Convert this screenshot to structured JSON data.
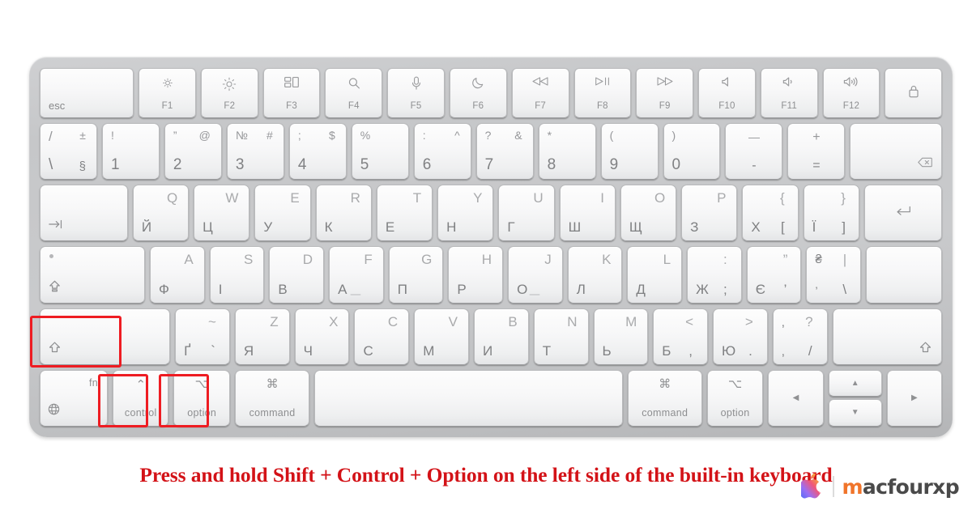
{
  "caption": "Press and hold Shift + Control + Option on the left side of the built-in keyboard",
  "brand": {
    "name_first": "m",
    "name_rest": "acfourxp",
    "apple_icon": "apple-logo-icon"
  },
  "colors": {
    "highlight": "#ee1c22",
    "caption_text": "#d31217",
    "key_face": "#f7f7f8",
    "chassis": "#c6c7c9",
    "latin_legend": "#a9aaac",
    "cyrillic_legend": "#7f8082"
  },
  "keyboard": {
    "layout_name": "Apple Magic Keyboard (Ukrainian / Latin)",
    "function_row": [
      {
        "name": "esc",
        "label": "esc"
      },
      {
        "name": "f1",
        "icon": "brightness-down-icon",
        "label": "F1"
      },
      {
        "name": "f2",
        "icon": "brightness-up-icon",
        "label": "F2"
      },
      {
        "name": "f3",
        "icon": "mission-control-icon",
        "label": "F3"
      },
      {
        "name": "f4",
        "icon": "spotlight-search-icon",
        "label": "F4"
      },
      {
        "name": "f5",
        "icon": "dictation-microphone-icon",
        "label": "F5"
      },
      {
        "name": "f6",
        "icon": "do-not-disturb-moon-icon",
        "label": "F6"
      },
      {
        "name": "f7",
        "icon": "rewind-icon",
        "label": "F7"
      },
      {
        "name": "f8",
        "icon": "play-pause-icon",
        "label": "F8"
      },
      {
        "name": "f9",
        "icon": "fast-forward-icon",
        "label": "F9"
      },
      {
        "name": "f10",
        "icon": "mute-icon",
        "label": "F10"
      },
      {
        "name": "f11",
        "icon": "volume-down-icon",
        "label": "F11"
      },
      {
        "name": "f12",
        "icon": "volume-up-icon",
        "label": "F12"
      },
      {
        "name": "touch-id",
        "icon": "lock-fingerprint-icon",
        "label": ""
      }
    ],
    "number_row": [
      {
        "name": "backslash",
        "top_left": "/",
        "bottom_left": "\\",
        "top_right": "±",
        "bottom_right": "§"
      },
      {
        "name": "1",
        "top_left": "!",
        "bottom_left": "1"
      },
      {
        "name": "2",
        "top_left": "”",
        "bottom_left": "2",
        "top_right": "@"
      },
      {
        "name": "3",
        "top_left": "№",
        "bottom_left": "3",
        "top_right": "#"
      },
      {
        "name": "4",
        "top_left": ";",
        "bottom_left": "4",
        "top_right": "$"
      },
      {
        "name": "5",
        "top_left": "%",
        "bottom_left": "5"
      },
      {
        "name": "6",
        "top_left": ":",
        "bottom_left": "6",
        "top_right": "^"
      },
      {
        "name": "7",
        "top_left": "?",
        "bottom_left": "7",
        "top_right": "&"
      },
      {
        "name": "8",
        "top_left": "*",
        "bottom_left": "8"
      },
      {
        "name": "9",
        "top_left": "(",
        "bottom_left": "9"
      },
      {
        "name": "0",
        "top_left": ")",
        "bottom_left": "0"
      },
      {
        "name": "minus",
        "top_center": "—",
        "bottom_center": "-"
      },
      {
        "name": "equals",
        "top_center": "+",
        "bottom_center": "="
      },
      {
        "name": "delete",
        "icon": "delete-backspace-icon"
      }
    ],
    "top_row": [
      {
        "name": "tab",
        "icon": "tab-arrow-icon"
      },
      {
        "name": "q",
        "latin": "Q",
        "cyrillic": "Й"
      },
      {
        "name": "w",
        "latin": "W",
        "cyrillic": "Ц"
      },
      {
        "name": "e",
        "latin": "E",
        "cyrillic": "У"
      },
      {
        "name": "r",
        "latin": "R",
        "cyrillic": "К"
      },
      {
        "name": "t",
        "latin": "T",
        "cyrillic": "Е"
      },
      {
        "name": "y",
        "latin": "Y",
        "cyrillic": "Н"
      },
      {
        "name": "u",
        "latin": "U",
        "cyrillic": "Г"
      },
      {
        "name": "i",
        "latin": "I",
        "cyrillic": "Ш"
      },
      {
        "name": "o",
        "latin": "O",
        "cyrillic": "Щ"
      },
      {
        "name": "p",
        "latin": "P",
        "cyrillic": "З"
      },
      {
        "name": "bracket-left",
        "latin": "{",
        "cyrillic": "Х",
        "extra_bottom": "["
      },
      {
        "name": "bracket-right",
        "latin": "}",
        "cyrillic": "Ї",
        "extra_bottom": "]"
      },
      {
        "name": "return",
        "icon": "return-enter-icon"
      }
    ],
    "home_row": [
      {
        "name": "caps-lock",
        "icon": "caps-lock-arrow-icon",
        "indicator": "caps-lock-indicator"
      },
      {
        "name": "a",
        "latin": "A",
        "cyrillic": "Ф"
      },
      {
        "name": "s",
        "latin": "S",
        "cyrillic": "І"
      },
      {
        "name": "d",
        "latin": "D",
        "cyrillic": "В"
      },
      {
        "name": "f",
        "latin": "F",
        "cyrillic": "А",
        "homing": true
      },
      {
        "name": "g",
        "latin": "G",
        "cyrillic": "П"
      },
      {
        "name": "h",
        "latin": "H",
        "cyrillic": "Р"
      },
      {
        "name": "j",
        "latin": "J",
        "cyrillic": "О",
        "homing": true
      },
      {
        "name": "k",
        "latin": "K",
        "cyrillic": "Л"
      },
      {
        "name": "l",
        "latin": "L",
        "cyrillic": "Д"
      },
      {
        "name": "semicolon",
        "latin": ":",
        "cyrillic": "Ж",
        "extra_bottom": ";"
      },
      {
        "name": "quote",
        "latin": "”",
        "cyrillic": "Є",
        "extra_bottom": "’"
      },
      {
        "name": "hryvnia",
        "latin": "|",
        "cyrillic": "₴",
        "extra_bottom": "\\",
        "extra_bottom_left": "’"
      },
      {
        "name": "return-lower",
        "icon": ""
      }
    ],
    "shift_row": [
      {
        "name": "shift-left",
        "icon": "shift-arrow-icon"
      },
      {
        "name": "grave",
        "latin": "~",
        "cyrillic": "Ґ",
        "extra_bottom": "`"
      },
      {
        "name": "z",
        "latin": "Z",
        "cyrillic": "Я"
      },
      {
        "name": "x",
        "latin": "X",
        "cyrillic": "Ч"
      },
      {
        "name": "c",
        "latin": "C",
        "cyrillic": "С"
      },
      {
        "name": "v",
        "latin": "V",
        "cyrillic": "М"
      },
      {
        "name": "b",
        "latin": "B",
        "cyrillic": "И"
      },
      {
        "name": "n",
        "latin": "N",
        "cyrillic": "Т"
      },
      {
        "name": "m",
        "latin": "M",
        "cyrillic": "Ь"
      },
      {
        "name": "comma",
        "latin": "<",
        "cyrillic": "Б",
        "extra_bottom": ","
      },
      {
        "name": "period",
        "latin": ">",
        "cyrillic": "Ю",
        "extra_bottom": "."
      },
      {
        "name": "slash",
        "latin": "?",
        "cyrillic": ",",
        "extra_bottom": "/",
        "extra_top_left": ","
      },
      {
        "name": "shift-right",
        "icon": "shift-arrow-icon"
      }
    ],
    "bottom_row": [
      {
        "name": "fn",
        "label": "fn",
        "icon": "globe-icon"
      },
      {
        "name": "control-left",
        "label": "control",
        "symbol": "⌃"
      },
      {
        "name": "option-left",
        "label": "option",
        "symbol": "⌥"
      },
      {
        "name": "command-left",
        "label": "command",
        "symbol": "⌘"
      },
      {
        "name": "space",
        "label": ""
      },
      {
        "name": "command-right",
        "label": "command",
        "symbol": "⌘"
      },
      {
        "name": "option-right",
        "label": "option",
        "symbol": "⌥"
      },
      {
        "name": "arrow-left",
        "symbol": "◀"
      },
      {
        "name": "arrow-up",
        "symbol": "▲"
      },
      {
        "name": "arrow-down",
        "symbol": "▼"
      },
      {
        "name": "arrow-right",
        "symbol": "▶"
      }
    ]
  },
  "highlights": [
    {
      "name": "highlight-shift-left",
      "target": "shift-left"
    },
    {
      "name": "highlight-control-left",
      "target": "control-left"
    },
    {
      "name": "highlight-option-left",
      "target": "option-left"
    }
  ]
}
